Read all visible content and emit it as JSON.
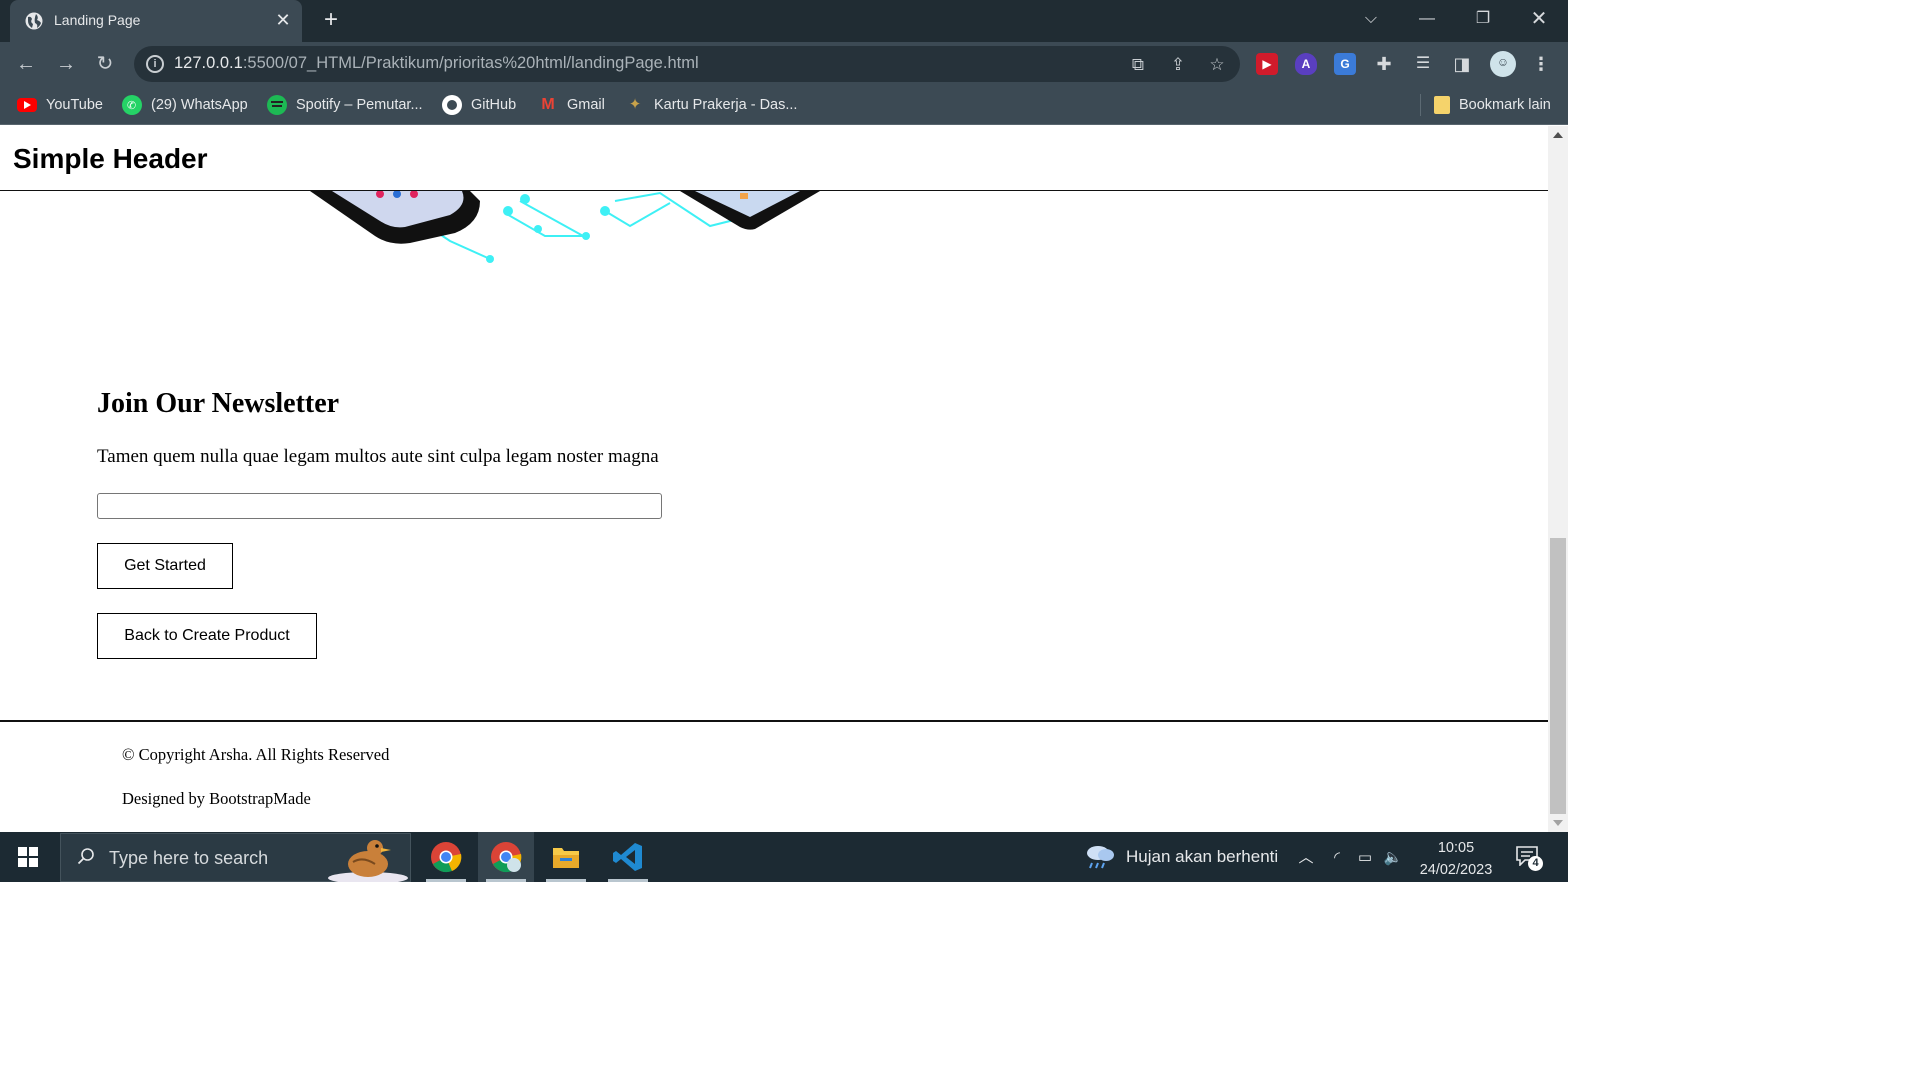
{
  "browser": {
    "tab_title": "Landing Page",
    "url_host": "127.0.0.1",
    "url_path": ":5500/07_HTML/Praktikum/prioritas%20html/landingPage.html",
    "bookmarks": [
      {
        "label": "YouTube",
        "icon": "youtube-icon",
        "color": "#ff0000"
      },
      {
        "label": "(29) WhatsApp",
        "icon": "whatsapp-icon",
        "color": "#25d366"
      },
      {
        "label": "Spotify – Pemutar...",
        "icon": "spotify-icon",
        "color": "#1db954"
      },
      {
        "label": "GitHub",
        "icon": "github-icon",
        "color": "#ffffff"
      },
      {
        "label": "Gmail",
        "icon": "gmail-icon",
        "color": "#ea4335"
      },
      {
        "label": "Kartu Prakerja - Das...",
        "icon": "prakerja-icon",
        "color": "#c8a24a"
      }
    ],
    "other_bookmarks": "Bookmark lain"
  },
  "page": {
    "header_title": "Simple Header",
    "newsletter_title": "Join Our Newsletter",
    "newsletter_text": "Tamen quem nulla quae legam multos aute sint culpa legam noster magna",
    "email_value": "",
    "get_started_label": "Get Started",
    "back_label": "Back to Create Product",
    "copyright": "© Copyright Arsha. All Rights Reserved",
    "designed_by": "Designed by BootstrapMade"
  },
  "taskbar": {
    "search_placeholder": "Type here to search",
    "weather_text": "Hujan akan berhenti",
    "time": "10:05",
    "date": "24/02/2023",
    "notification_count": "4"
  }
}
